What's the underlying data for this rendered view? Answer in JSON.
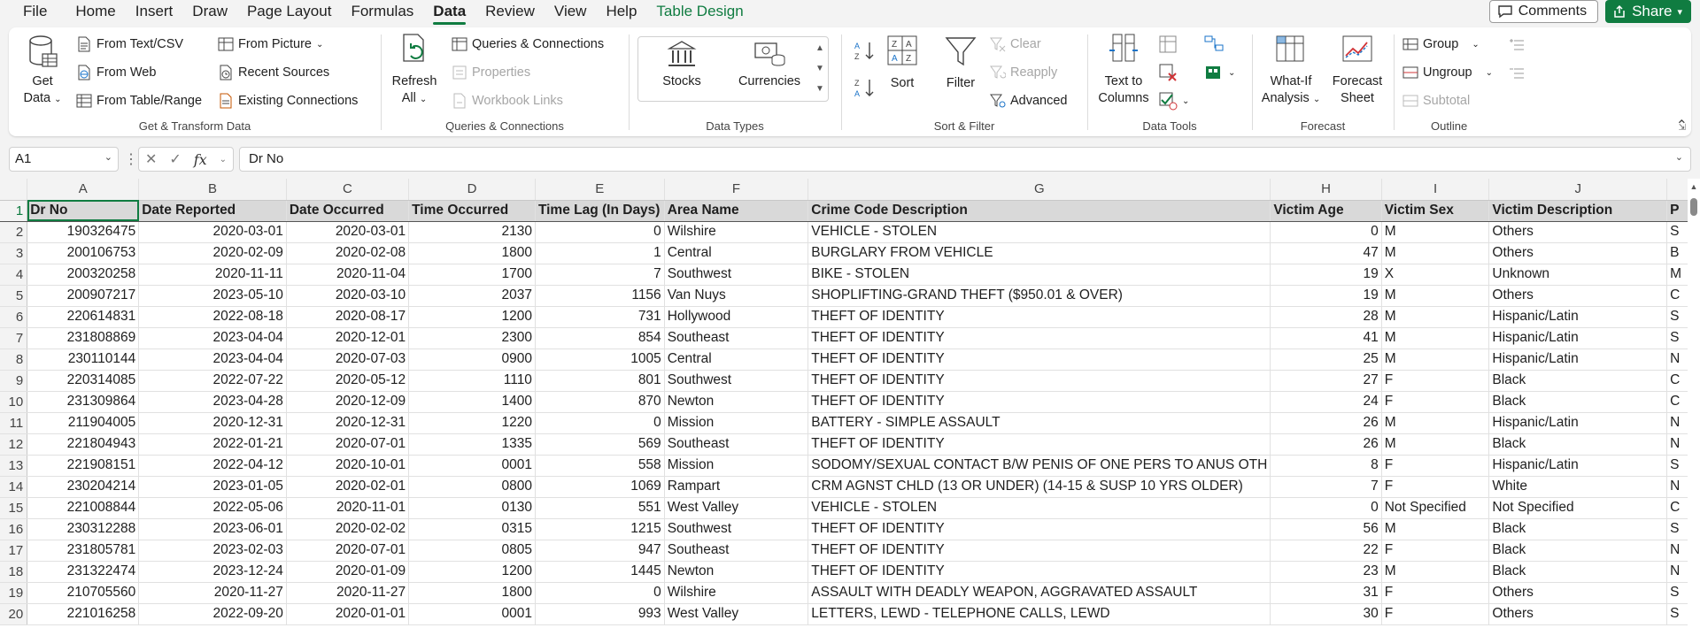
{
  "menu": {
    "items": [
      "File",
      "Home",
      "Insert",
      "Draw",
      "Page Layout",
      "Formulas",
      "Data",
      "Review",
      "View",
      "Help",
      "Table Design"
    ],
    "active": "Data",
    "comments_label": "Comments",
    "share_label": "Share"
  },
  "ribbon": {
    "get_transform": {
      "label": "Get & Transform Data",
      "get_data": "Get",
      "get_data2": "Data",
      "from_text": "From Text/CSV",
      "from_web": "From Web",
      "from_table": "From Table/Range",
      "from_picture": "From Picture",
      "recent_sources": "Recent Sources",
      "existing_connections": "Existing Connections"
    },
    "queries": {
      "label": "Queries & Connections",
      "refresh": "Refresh",
      "refresh2": "All",
      "queries_connections": "Queries & Connections",
      "properties": "Properties",
      "workbook_links": "Workbook Links"
    },
    "data_types": {
      "label": "Data Types",
      "stocks": "Stocks",
      "currencies": "Currencies"
    },
    "sort_filter": {
      "label": "Sort & Filter",
      "sort": "Sort",
      "filter": "Filter",
      "clear": "Clear",
      "reapply": "Reapply",
      "advanced": "Advanced"
    },
    "data_tools": {
      "label": "Data Tools",
      "text_to_columns": "Text to",
      "text_to_columns2": "Columns"
    },
    "forecast": {
      "label": "Forecast",
      "what_if": "What-If",
      "what_if2": "Analysis",
      "forecast_sheet": "Forecast",
      "forecast_sheet2": "Sheet"
    },
    "outline": {
      "label": "Outline",
      "group": "Group",
      "ungroup": "Ungroup",
      "subtotal": "Subtotal"
    }
  },
  "formula_bar": {
    "name_box": "A1",
    "fx": "fx",
    "value": "Dr No"
  },
  "sheet": {
    "columns": [
      "A",
      "B",
      "C",
      "D",
      "E",
      "F",
      "G",
      "H",
      "I",
      "J"
    ],
    "headers": [
      "Dr No",
      "Date Reported",
      "Date Occurred",
      "Time Occurred",
      "Time Lag (In Days)",
      "Area Name",
      "Crime Code Description",
      "Victim Age",
      "Victim Sex",
      "Victim Description",
      "P"
    ],
    "rows": [
      [
        "190326475",
        "2020-03-01",
        "2020-03-01",
        "2130",
        "0",
        "Wilshire",
        "VEHICLE - STOLEN",
        "0",
        "M",
        "Others",
        "S"
      ],
      [
        "200106753",
        "2020-02-09",
        "2020-02-08",
        "1800",
        "1",
        "Central",
        "BURGLARY FROM VEHICLE",
        "47",
        "M",
        "Others",
        "B"
      ],
      [
        "200320258",
        "2020-11-11",
        "2020-11-04",
        "1700",
        "7",
        "Southwest",
        "BIKE - STOLEN",
        "19",
        "X",
        "Unknown",
        "M"
      ],
      [
        "200907217",
        "2023-05-10",
        "2020-03-10",
        "2037",
        "1156",
        "Van Nuys",
        "SHOPLIFTING-GRAND THEFT ($950.01 & OVER)",
        "19",
        "M",
        "Others",
        "C"
      ],
      [
        "220614831",
        "2022-08-18",
        "2020-08-17",
        "1200",
        "731",
        "Hollywood",
        "THEFT OF IDENTITY",
        "28",
        "M",
        "Hispanic/Latin",
        "S"
      ],
      [
        "231808869",
        "2023-04-04",
        "2020-12-01",
        "2300",
        "854",
        "Southeast",
        "THEFT OF IDENTITY",
        "41",
        "M",
        "Hispanic/Latin",
        "S"
      ],
      [
        "230110144",
        "2023-04-04",
        "2020-07-03",
        "0900",
        "1005",
        "Central",
        "THEFT OF IDENTITY",
        "25",
        "M",
        "Hispanic/Latin",
        "N"
      ],
      [
        "220314085",
        "2022-07-22",
        "2020-05-12",
        "1110",
        "801",
        "Southwest",
        "THEFT OF IDENTITY",
        "27",
        "F",
        "Black",
        "C"
      ],
      [
        "231309864",
        "2023-04-28",
        "2020-12-09",
        "1400",
        "870",
        "Newton",
        "THEFT OF IDENTITY",
        "24",
        "F",
        "Black",
        "C"
      ],
      [
        "211904005",
        "2020-12-31",
        "2020-12-31",
        "1220",
        "0",
        "Mission",
        "BATTERY - SIMPLE ASSAULT",
        "26",
        "M",
        "Hispanic/Latin",
        "N"
      ],
      [
        "221804943",
        "2022-01-21",
        "2020-07-01",
        "1335",
        "569",
        "Southeast",
        "THEFT OF IDENTITY",
        "26",
        "M",
        "Black",
        "N"
      ],
      [
        "221908151",
        "2022-04-12",
        "2020-10-01",
        "0001",
        "558",
        "Mission",
        "SODOMY/SEXUAL CONTACT B/W PENIS OF ONE PERS TO ANUS OTH",
        "8",
        "F",
        "Hispanic/Latin",
        "S"
      ],
      [
        "230204214",
        "2023-01-05",
        "2020-02-01",
        "0800",
        "1069",
        "Rampart",
        "CRM AGNST CHLD (13 OR UNDER) (14-15 & SUSP 10 YRS OLDER)",
        "7",
        "F",
        "White",
        "N"
      ],
      [
        "221008844",
        "2022-05-06",
        "2020-11-01",
        "0130",
        "551",
        "West Valley",
        "VEHICLE - STOLEN",
        "0",
        "Not Specified",
        "Not Specified",
        "C"
      ],
      [
        "230312288",
        "2023-06-01",
        "2020-02-02",
        "0315",
        "1215",
        "Southwest",
        "THEFT OF IDENTITY",
        "56",
        "M",
        "Black",
        "S"
      ],
      [
        "231805781",
        "2023-02-03",
        "2020-07-01",
        "0805",
        "947",
        "Southeast",
        "THEFT OF IDENTITY",
        "22",
        "F",
        "Black",
        "N"
      ],
      [
        "231322474",
        "2023-12-24",
        "2020-01-09",
        "1200",
        "1445",
        "Newton",
        "THEFT OF IDENTITY",
        "23",
        "M",
        "Black",
        "N"
      ],
      [
        "210705560",
        "2020-11-27",
        "2020-11-27",
        "1800",
        "0",
        "Wilshire",
        "ASSAULT WITH DEADLY WEAPON, AGGRAVATED ASSAULT",
        "31",
        "F",
        "Others",
        "S"
      ],
      [
        "221016258",
        "2022-09-20",
        "2020-01-01",
        "0001",
        "993",
        "West Valley",
        "LETTERS, LEWD  -  TELEPHONE CALLS, LEWD",
        "30",
        "F",
        "Others",
        "S"
      ]
    ]
  }
}
